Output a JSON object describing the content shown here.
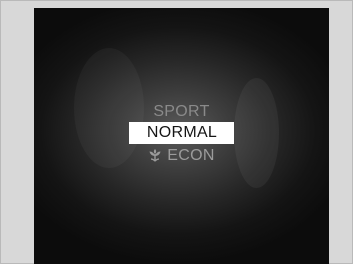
{
  "colors": {
    "frame_bg": "#d8d8d8",
    "screen_dark": "#0c0c0c",
    "highlight_bg": "#ffffff",
    "highlight_text": "#151515",
    "inactive_text": "#8a8a8a"
  },
  "drive_mode_menu": {
    "items": [
      {
        "label": "SPORT",
        "selected": false,
        "icon": ""
      },
      {
        "label": "NORMAL",
        "selected": true,
        "icon": ""
      },
      {
        "label": "ECON",
        "selected": false,
        "icon": "eco-leaf-icon"
      }
    ]
  }
}
